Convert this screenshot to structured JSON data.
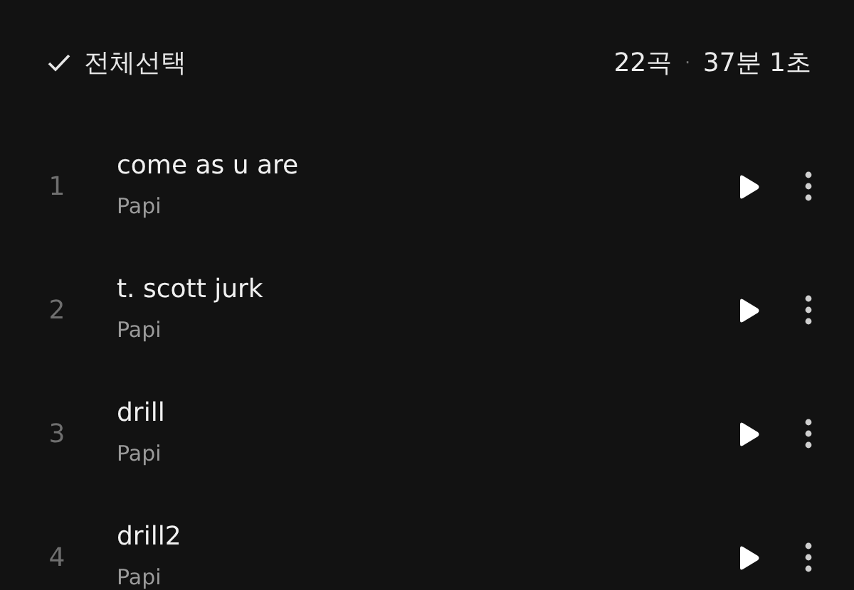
{
  "header": {
    "select_all": "전체선택",
    "track_count": "22곡",
    "separator": "·",
    "duration": "37분 1초"
  },
  "tracks": [
    {
      "number": "1",
      "title": "come as u are",
      "artist": "Papi"
    },
    {
      "number": "2",
      "title": "t. scott jurk",
      "artist": "Papi"
    },
    {
      "number": "3",
      "title": "drill",
      "artist": "Papi"
    },
    {
      "number": "4",
      "title": "drill2",
      "artist": "Papi"
    }
  ]
}
